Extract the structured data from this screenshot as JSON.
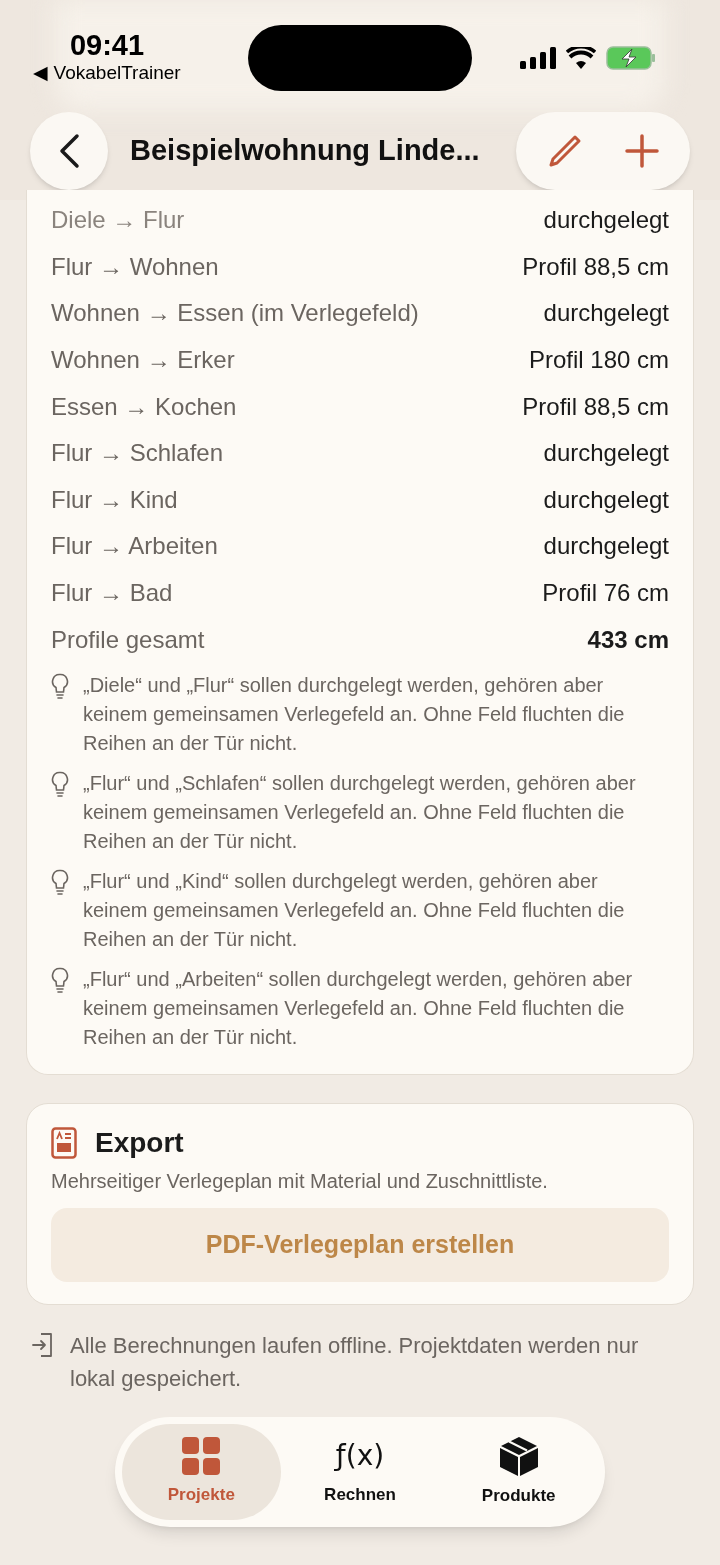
{
  "status_bar": {
    "time": "09:41",
    "back_app": "◀ VokabelTrainer"
  },
  "nav": {
    "title": "Beispielwohnung Linde..."
  },
  "transitions": [
    {
      "label": "Diele → Flur",
      "value": "durchgelegt"
    },
    {
      "label": "Flur → Wohnen",
      "value": "Profil 88,5 cm"
    },
    {
      "label": "Wohnen → Essen (im Verlegefeld)",
      "value": "durchgelegt"
    },
    {
      "label": "Wohnen → Erker",
      "value": "Profil 180 cm"
    },
    {
      "label": "Essen → Kochen",
      "value": "Profil 88,5 cm"
    },
    {
      "label": "Flur → Schlafen",
      "value": "durchgelegt"
    },
    {
      "label": "Flur → Kind",
      "value": "durchgelegt"
    },
    {
      "label": "Flur → Arbeiten",
      "value": "durchgelegt"
    },
    {
      "label": "Flur → Bad",
      "value": "Profil 76 cm"
    }
  ],
  "total": {
    "label": "Profile gesamt",
    "value": "433 cm"
  },
  "hints": [
    "„Diele“ und „Flur“ sollen durchgelegt werden, gehören aber keinem gemeinsamen Verlegefeld an. Ohne Feld fluchten die Reihen an der Tür nicht.",
    "„Flur“ und „Schlafen“ sollen durchgelegt werden, gehören aber keinem gemeinsamen Verlegefeld an. Ohne Feld fluchten die Reihen an der Tür nicht.",
    "„Flur“ und „Kind“ sollen durchgelegt werden, gehören aber keinem gemeinsamen Verlegefeld an. Ohne Feld fluchten die Reihen an der Tür nicht.",
    "„Flur“ und „Arbeiten“ sollen durchgelegt werden, gehören aber keinem gemeinsamen Verlegefeld an. Ohne Feld fluchten die Reihen an der Tür nicht."
  ],
  "export": {
    "title": "Export",
    "description": "Mehrseitiger Verlegeplan mit Material und Zuschnittliste.",
    "button": "PDF-Verlegeplan erstellen"
  },
  "footer_note": "Alle Berechnungen laufen offline. Projektdaten werden nur lokal gespeichert.",
  "tabs": [
    {
      "kind": "grid",
      "label": "Projekte",
      "selected": true
    },
    {
      "kind": "function",
      "icon_text": "ƒ(x)",
      "label": "Rechnen",
      "selected": false
    },
    {
      "kind": "box",
      "label": "Produkte",
      "selected": false
    }
  ]
}
